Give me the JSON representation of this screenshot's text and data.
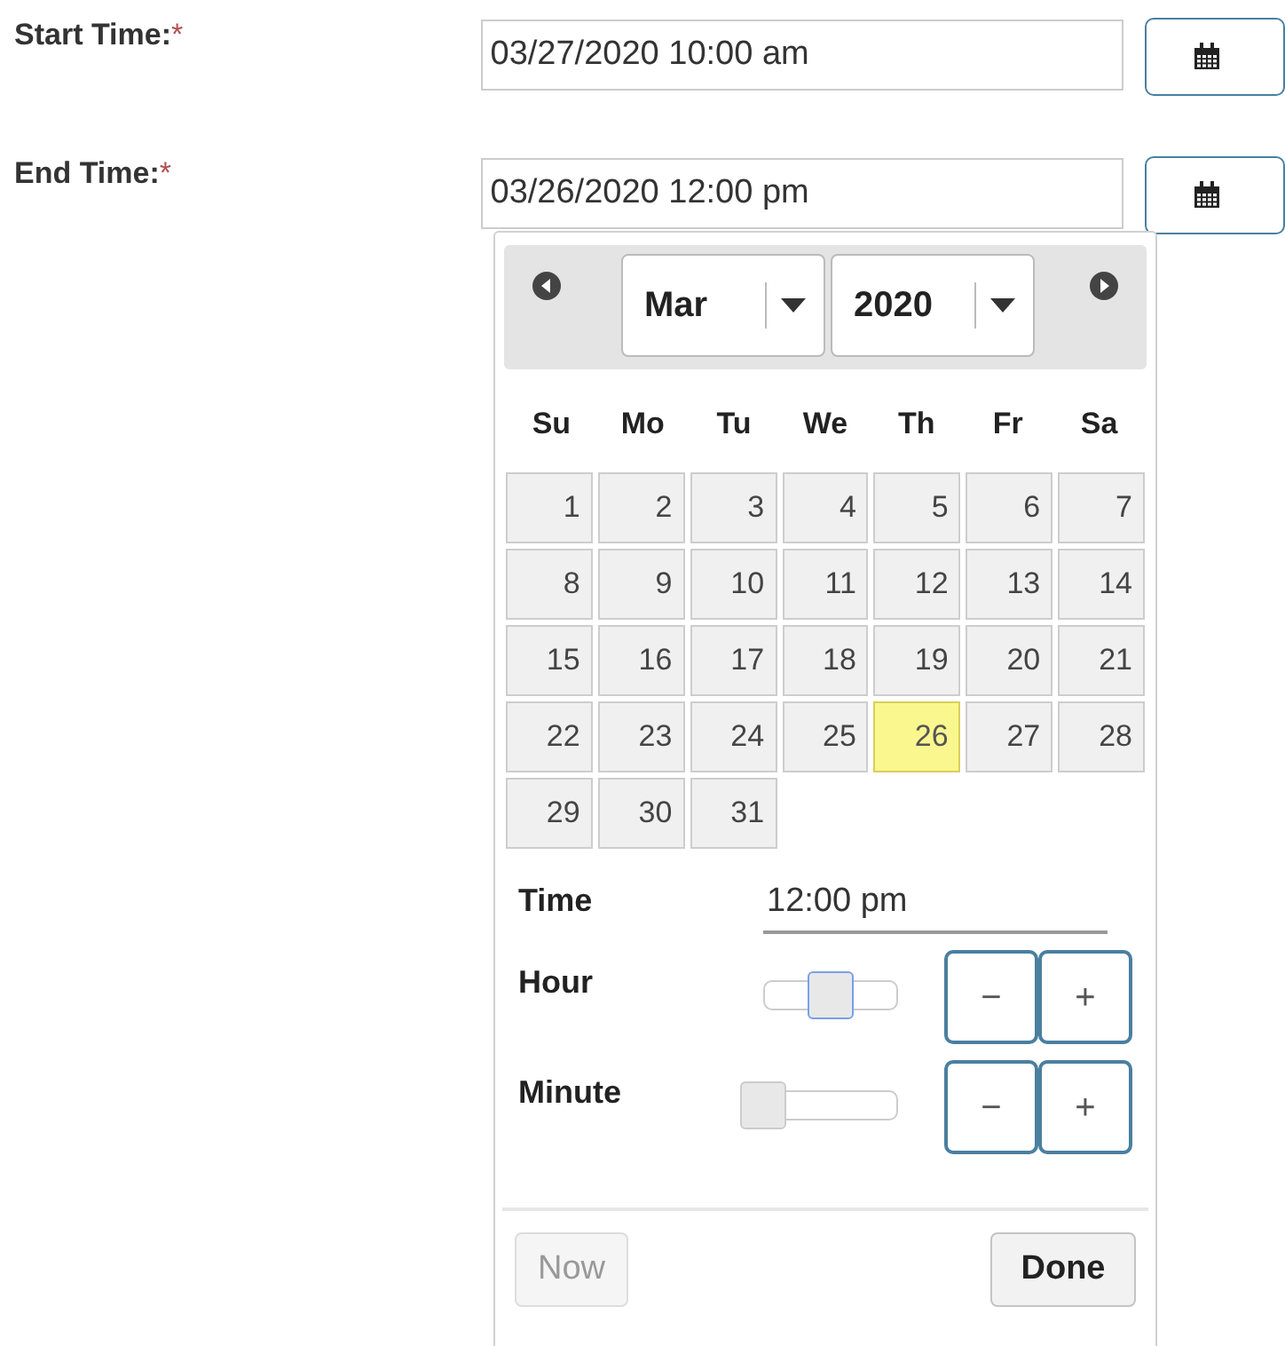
{
  "fields": [
    {
      "label": "Start Time:",
      "required_mark": "*",
      "value": "03/27/2020 10:00 am"
    },
    {
      "label": "End Time:",
      "required_mark": "*",
      "value": "03/26/2020 12:00 pm"
    }
  ],
  "datepicker": {
    "month": "Mar",
    "year": "2020",
    "weekdays": [
      "Su",
      "Mo",
      "Tu",
      "We",
      "Th",
      "Fr",
      "Sa"
    ],
    "days": [
      {
        "label": "1",
        "selected": false
      },
      {
        "label": "2",
        "selected": false
      },
      {
        "label": "3",
        "selected": false
      },
      {
        "label": "4",
        "selected": false
      },
      {
        "label": "5",
        "selected": false
      },
      {
        "label": "6",
        "selected": false
      },
      {
        "label": "7",
        "selected": false
      },
      {
        "label": "8",
        "selected": false
      },
      {
        "label": "9",
        "selected": false
      },
      {
        "label": "10",
        "selected": false
      },
      {
        "label": "11",
        "selected": false
      },
      {
        "label": "12",
        "selected": false
      },
      {
        "label": "13",
        "selected": false
      },
      {
        "label": "14",
        "selected": false
      },
      {
        "label": "15",
        "selected": false
      },
      {
        "label": "16",
        "selected": false
      },
      {
        "label": "17",
        "selected": false
      },
      {
        "label": "18",
        "selected": false
      },
      {
        "label": "19",
        "selected": false
      },
      {
        "label": "20",
        "selected": false
      },
      {
        "label": "21",
        "selected": false
      },
      {
        "label": "22",
        "selected": false
      },
      {
        "label": "23",
        "selected": false
      },
      {
        "label": "24",
        "selected": false
      },
      {
        "label": "25",
        "selected": false
      },
      {
        "label": "26",
        "selected": true
      },
      {
        "label": "27",
        "selected": false
      },
      {
        "label": "28",
        "selected": false
      },
      {
        "label": "29",
        "selected": false
      },
      {
        "label": "30",
        "selected": false
      },
      {
        "label": "31",
        "selected": false
      }
    ],
    "time": {
      "label": "Time",
      "value": "12:00 pm"
    },
    "sliders": [
      {
        "label": "Hour",
        "level": 0.5,
        "focused": true,
        "minus": "−",
        "plus": "+"
      },
      {
        "label": "Minute",
        "level": 0,
        "focused": false,
        "minus": "−",
        "plus": "+"
      }
    ],
    "buttons": [
      {
        "label": "Now",
        "disabled": true
      },
      {
        "label": "Done",
        "disabled": false
      }
    ]
  }
}
